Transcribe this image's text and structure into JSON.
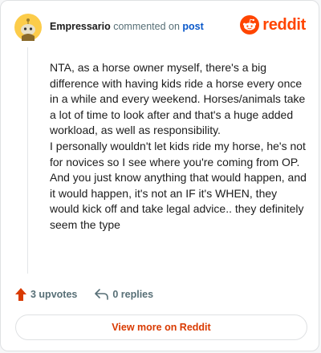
{
  "header": {
    "author": "Empressario",
    "action_text": "commented on",
    "post_link": "post"
  },
  "brand": {
    "name": "reddit",
    "icon": "reddit-logo-icon",
    "color": "#ff4500"
  },
  "comment": {
    "paragraphs": [
      "NTA, as a horse owner myself, there's a big difference with having kids ride a horse every once in a while and every weekend. Horses/animals take a lot of time to look after and that's a huge added workload, as well as responsibility.",
      "I personally wouldn't let kids ride my horse, he's not for novices so I see where you're coming from OP. And you just know anything that would happen, and it would happen, it's not an IF it's WHEN, they would kick off and take legal advice.. they definitely seem the type"
    ]
  },
  "actions": {
    "upvotes_label": "3 upvotes",
    "upvote_icon": "upvote-arrow-icon",
    "replies_label": "0 replies",
    "reply_icon": "reply-arrow-icon"
  },
  "footer": {
    "view_more_label": "View more on Reddit"
  },
  "colors": {
    "accent": "#d93a00",
    "upvote": "#d93a00",
    "link": "#0a58ca",
    "muted": "#576f76"
  }
}
